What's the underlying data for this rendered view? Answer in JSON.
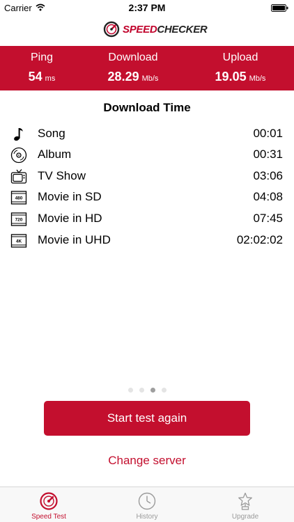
{
  "status_bar": {
    "carrier": "Carrier",
    "time": "2:37 PM"
  },
  "header": {
    "logo_speed": "SPEED",
    "logo_checker": "CHECKER"
  },
  "stats": {
    "ping": {
      "label": "Ping",
      "value": "54",
      "unit": "ms"
    },
    "download": {
      "label": "Download",
      "value": "28.29",
      "unit": "Mb/s"
    },
    "upload": {
      "label": "Upload",
      "value": "19.05",
      "unit": "Mb/s"
    }
  },
  "download_time": {
    "title": "Download Time",
    "rows": [
      {
        "icon": "music-note-icon",
        "label": "Song",
        "time": "00:01"
      },
      {
        "icon": "disc-icon",
        "label": "Album",
        "time": "00:31"
      },
      {
        "icon": "tv-icon",
        "label": "TV Show",
        "time": "03:06"
      },
      {
        "icon": "film-480-icon",
        "label": "Movie in SD",
        "time": "04:08",
        "badge": "480"
      },
      {
        "icon": "film-720-icon",
        "label": "Movie in HD",
        "time": "07:45",
        "badge": "720"
      },
      {
        "icon": "film-4k-icon",
        "label": "Movie in UHD",
        "time": "02:02:02",
        "badge": "4K"
      }
    ]
  },
  "pager": {
    "count": 4,
    "active_index": 2
  },
  "actions": {
    "start_button": "Start test again",
    "change_server": "Change server"
  },
  "tab_bar": {
    "tabs": [
      {
        "label": "Speed Test",
        "icon": "speedometer-icon",
        "active": true
      },
      {
        "label": "History",
        "icon": "clock-icon",
        "active": false
      },
      {
        "label": "Upgrade",
        "icon": "star-trophy-icon",
        "active": false
      }
    ]
  },
  "colors": {
    "accent": "#c30f2e",
    "inactive_tab": "#9a9a9a",
    "dot_active": "#9e9e9e",
    "dot_inactive": "#e4e4e4"
  }
}
